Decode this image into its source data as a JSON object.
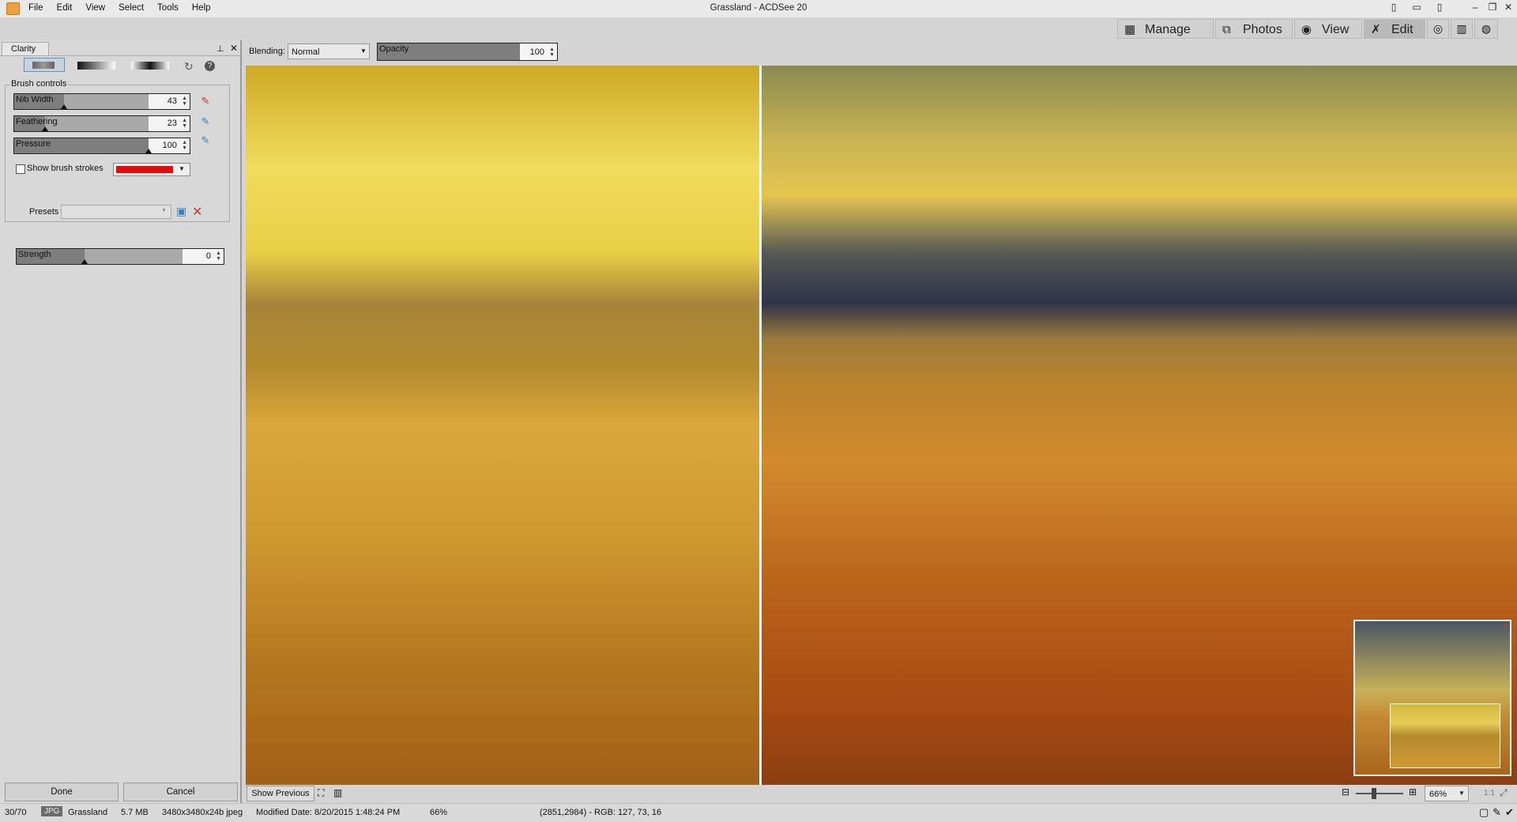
{
  "window": {
    "title": "Grassland - ACDSee 20",
    "menu": [
      "File",
      "Edit",
      "View",
      "Select",
      "Tools",
      "Help"
    ]
  },
  "modes": [
    {
      "label": "Manage",
      "icon": "grid-icon"
    },
    {
      "label": "Photos",
      "icon": "photos-icon"
    },
    {
      "label": "View",
      "icon": "eye-icon"
    },
    {
      "label": "Edit",
      "icon": "edit-tools-icon",
      "active": true
    }
  ],
  "mode_extras": [
    "365-icon",
    "histogram-icon",
    "develop-eye-icon"
  ],
  "panel": {
    "tab": "Clarity",
    "brush_group_title": "Brush controls",
    "sliders": [
      {
        "label": "Nib Width",
        "value": "43",
        "fraction": 0.43
      },
      {
        "label": "Feathering",
        "value": "23",
        "fraction": 0.23
      },
      {
        "label": "Pressure",
        "value": "100",
        "fraction": 1.0
      }
    ],
    "show_strokes_label": "Show brush strokes",
    "stroke_color": "#e30d0d",
    "presets_label": "Presets",
    "strength": {
      "label": "Strength",
      "value": "0",
      "fraction": 0.5
    },
    "done_label": "Done",
    "cancel_label": "Cancel"
  },
  "options_bar": {
    "blending_label": "Blending:",
    "blending_value": "Normal",
    "opacity_label": "Opacity",
    "opacity_value": "100"
  },
  "bottom": {
    "show_previous": "Show Previous",
    "zoom_value": "66%",
    "one_to_one": "1:1"
  },
  "status": {
    "position": "30/70",
    "type": "JPG",
    "filename": "Grassland",
    "size": "5.7 MB",
    "dims": "3480x3480x24b jpeg",
    "modified": "Modified Date: 8/20/2015 1:48:24 PM",
    "zoom": "66%",
    "pixel": "(2851,2984) - RGB: 127, 73, 16"
  }
}
